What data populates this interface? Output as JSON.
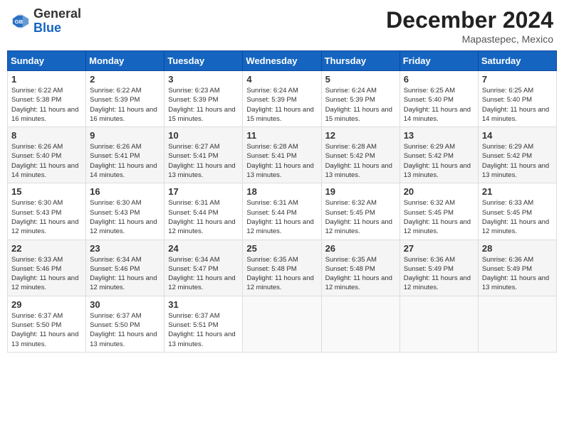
{
  "header": {
    "logo_general": "General",
    "logo_blue": "Blue",
    "month_title": "December 2024",
    "location": "Mapastepec, Mexico"
  },
  "calendar": {
    "days_of_week": [
      "Sunday",
      "Monday",
      "Tuesday",
      "Wednesday",
      "Thursday",
      "Friday",
      "Saturday"
    ],
    "weeks": [
      [
        null,
        null,
        null,
        null,
        {
          "day": 5,
          "sunrise": "6:24 AM",
          "sunset": "5:39 PM",
          "daylight": "11 hours and 15 minutes."
        },
        {
          "day": 6,
          "sunrise": "6:25 AM",
          "sunset": "5:40 PM",
          "daylight": "11 hours and 14 minutes."
        },
        {
          "day": 7,
          "sunrise": "6:25 AM",
          "sunset": "5:40 PM",
          "daylight": "11 hours and 14 minutes."
        }
      ],
      [
        {
          "day": 1,
          "sunrise": "6:22 AM",
          "sunset": "5:38 PM",
          "daylight": "11 hours and 16 minutes."
        },
        {
          "day": 2,
          "sunrise": "6:22 AM",
          "sunset": "5:39 PM",
          "daylight": "11 hours and 16 minutes."
        },
        {
          "day": 3,
          "sunrise": "6:23 AM",
          "sunset": "5:39 PM",
          "daylight": "11 hours and 15 minutes."
        },
        {
          "day": 4,
          "sunrise": "6:24 AM",
          "sunset": "5:39 PM",
          "daylight": "11 hours and 15 minutes."
        },
        {
          "day": 5,
          "sunrise": "6:24 AM",
          "sunset": "5:39 PM",
          "daylight": "11 hours and 15 minutes."
        },
        {
          "day": 6,
          "sunrise": "6:25 AM",
          "sunset": "5:40 PM",
          "daylight": "11 hours and 14 minutes."
        },
        {
          "day": 7,
          "sunrise": "6:25 AM",
          "sunset": "5:40 PM",
          "daylight": "11 hours and 14 minutes."
        }
      ],
      [
        {
          "day": 8,
          "sunrise": "6:26 AM",
          "sunset": "5:40 PM",
          "daylight": "11 hours and 14 minutes."
        },
        {
          "day": 9,
          "sunrise": "6:26 AM",
          "sunset": "5:41 PM",
          "daylight": "11 hours and 14 minutes."
        },
        {
          "day": 10,
          "sunrise": "6:27 AM",
          "sunset": "5:41 PM",
          "daylight": "11 hours and 13 minutes."
        },
        {
          "day": 11,
          "sunrise": "6:28 AM",
          "sunset": "5:41 PM",
          "daylight": "11 hours and 13 minutes."
        },
        {
          "day": 12,
          "sunrise": "6:28 AM",
          "sunset": "5:42 PM",
          "daylight": "11 hours and 13 minutes."
        },
        {
          "day": 13,
          "sunrise": "6:29 AM",
          "sunset": "5:42 PM",
          "daylight": "11 hours and 13 minutes."
        },
        {
          "day": 14,
          "sunrise": "6:29 AM",
          "sunset": "5:42 PM",
          "daylight": "11 hours and 13 minutes."
        }
      ],
      [
        {
          "day": 15,
          "sunrise": "6:30 AM",
          "sunset": "5:43 PM",
          "daylight": "11 hours and 12 minutes."
        },
        {
          "day": 16,
          "sunrise": "6:30 AM",
          "sunset": "5:43 PM",
          "daylight": "11 hours and 12 minutes."
        },
        {
          "day": 17,
          "sunrise": "6:31 AM",
          "sunset": "5:44 PM",
          "daylight": "11 hours and 12 minutes."
        },
        {
          "day": 18,
          "sunrise": "6:31 AM",
          "sunset": "5:44 PM",
          "daylight": "11 hours and 12 minutes."
        },
        {
          "day": 19,
          "sunrise": "6:32 AM",
          "sunset": "5:45 PM",
          "daylight": "11 hours and 12 minutes."
        },
        {
          "day": 20,
          "sunrise": "6:32 AM",
          "sunset": "5:45 PM",
          "daylight": "11 hours and 12 minutes."
        },
        {
          "day": 21,
          "sunrise": "6:33 AM",
          "sunset": "5:45 PM",
          "daylight": "11 hours and 12 minutes."
        }
      ],
      [
        {
          "day": 22,
          "sunrise": "6:33 AM",
          "sunset": "5:46 PM",
          "daylight": "11 hours and 12 minutes."
        },
        {
          "day": 23,
          "sunrise": "6:34 AM",
          "sunset": "5:46 PM",
          "daylight": "11 hours and 12 minutes."
        },
        {
          "day": 24,
          "sunrise": "6:34 AM",
          "sunset": "5:47 PM",
          "daylight": "11 hours and 12 minutes."
        },
        {
          "day": 25,
          "sunrise": "6:35 AM",
          "sunset": "5:48 PM",
          "daylight": "11 hours and 12 minutes."
        },
        {
          "day": 26,
          "sunrise": "6:35 AM",
          "sunset": "5:48 PM",
          "daylight": "11 hours and 12 minutes."
        },
        {
          "day": 27,
          "sunrise": "6:36 AM",
          "sunset": "5:49 PM",
          "daylight": "11 hours and 12 minutes."
        },
        {
          "day": 28,
          "sunrise": "6:36 AM",
          "sunset": "5:49 PM",
          "daylight": "11 hours and 13 minutes."
        }
      ],
      [
        {
          "day": 29,
          "sunrise": "6:37 AM",
          "sunset": "5:50 PM",
          "daylight": "11 hours and 13 minutes."
        },
        {
          "day": 30,
          "sunrise": "6:37 AM",
          "sunset": "5:50 PM",
          "daylight": "11 hours and 13 minutes."
        },
        {
          "day": 31,
          "sunrise": "6:37 AM",
          "sunset": "5:51 PM",
          "daylight": "11 hours and 13 minutes."
        },
        null,
        null,
        null,
        null
      ]
    ]
  }
}
